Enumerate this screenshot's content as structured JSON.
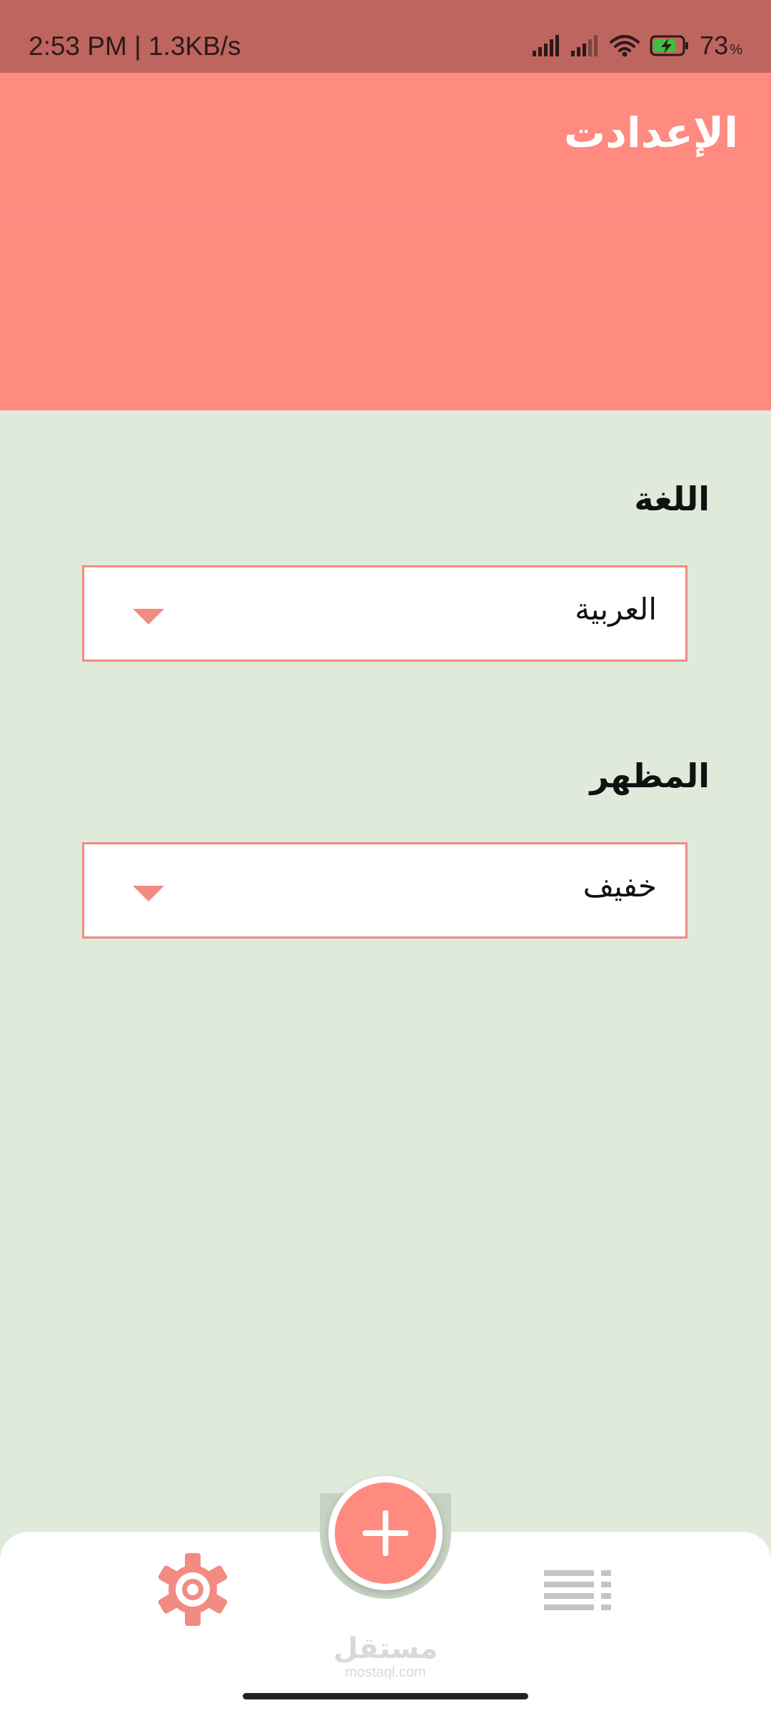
{
  "status_bar": {
    "time_speed": "2:53 PM | 1.3KB/s",
    "battery_percent": "73",
    "battery_unit": "%",
    "icons": [
      "signal-icon",
      "signal-icon",
      "wifi-icon",
      "battery-charging-icon"
    ]
  },
  "header": {
    "title": "الإعدادت"
  },
  "settings": {
    "language": {
      "label": "اللغة",
      "selected": "العربية"
    },
    "theme": {
      "label": "المظهر",
      "selected": "خفيف"
    }
  },
  "bottom_nav": {
    "items": [
      "gear-icon",
      "plus-icon",
      "list-icon"
    ]
  },
  "watermark": {
    "arabic": "مستقل",
    "latin": "mostaql.com"
  },
  "colors": {
    "status_bar": "#bf6560",
    "accent": "#ff8a80",
    "background": "#dfeadb",
    "border": "#f28b82",
    "nav_inactive": "#c4c4c4"
  }
}
